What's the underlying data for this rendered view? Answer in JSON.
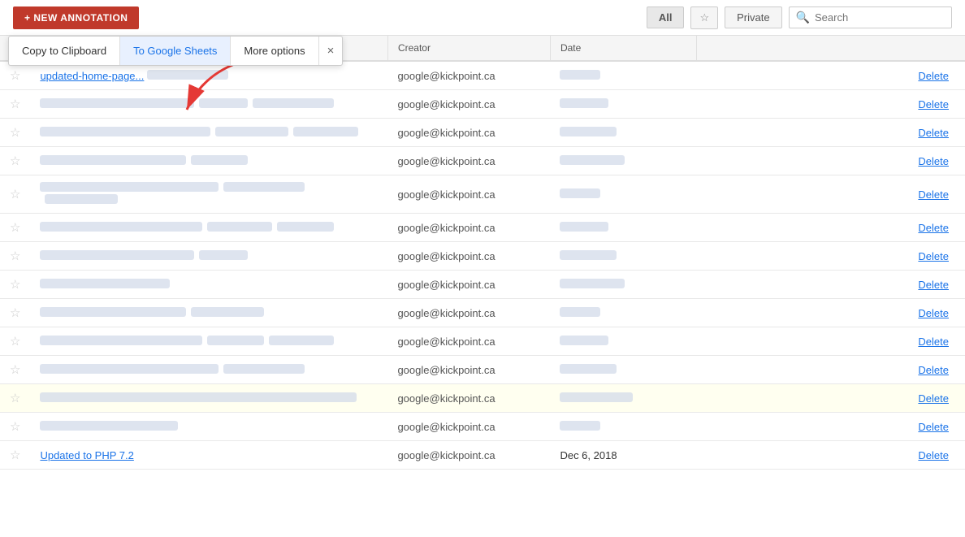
{
  "header": {
    "new_annotation_label": "+ NEW ANNOTATION",
    "filter_all": "All",
    "filter_private": "Private",
    "search_placeholder": "Search"
  },
  "export_popup": {
    "copy_label": "Copy to Clipboard",
    "sheets_label": "To Google Sheets",
    "more_label": "More options",
    "close_label": "×"
  },
  "table": {
    "col_sort_arrow": "↑",
    "col_creator": "Creator",
    "col_date": "Date",
    "delete_label": "Delete",
    "rows": [
      {
        "star": false,
        "content_link": "updated-home-page...",
        "content_blur_widths": [
          200,
          80
        ],
        "creator": "google@kickpoint.ca",
        "date": "",
        "highlighted": false
      },
      {
        "star": false,
        "content_link": "",
        "content_blur_widths": [
          190,
          60,
          100
        ],
        "creator": "google@kickpoint.ca",
        "date": "",
        "highlighted": false
      },
      {
        "star": false,
        "content_link": "",
        "content_blur_widths": [
          210,
          90,
          80
        ],
        "creator": "google@kickpoint.ca",
        "date": "",
        "highlighted": false
      },
      {
        "star": false,
        "content_link": "",
        "content_blur_widths": [
          180,
          70
        ],
        "creator": "google@kickpoint.ca",
        "date": "",
        "highlighted": false
      },
      {
        "star": false,
        "content_link": "",
        "content_blur_widths": [
          220,
          100,
          90
        ],
        "creator": "google@kickpoint.ca",
        "date": "",
        "highlighted": false
      },
      {
        "star": false,
        "content_link": "",
        "content_blur_widths": [
          200,
          80,
          70
        ],
        "creator": "google@kickpoint.ca",
        "date": "",
        "highlighted": false
      },
      {
        "star": false,
        "content_link": "",
        "content_blur_widths": [
          190,
          60
        ],
        "creator": "google@kickpoint.ca",
        "date": "",
        "highlighted": false
      },
      {
        "star": false,
        "content_link": "",
        "content_blur_widths": [
          160
        ],
        "creator": "google@kickpoint.ca",
        "date": "",
        "highlighted": false
      },
      {
        "star": false,
        "content_link": "",
        "content_blur_widths": [
          180,
          90
        ],
        "creator": "google@kickpoint.ca",
        "date": "",
        "highlighted": false
      },
      {
        "star": false,
        "content_link": "",
        "content_blur_widths": [
          200,
          70,
          80
        ],
        "creator": "google@kickpoint.ca",
        "date": "",
        "highlighted": false
      },
      {
        "star": false,
        "content_link": "",
        "content_blur_widths": [
          220,
          100
        ],
        "creator": "google@kickpoint.ca",
        "date": "",
        "highlighted": false
      },
      {
        "star": false,
        "content_link": "",
        "content_blur_widths": [
          390
        ],
        "creator": "google@kickpoint.ca",
        "date": "",
        "highlighted": true
      },
      {
        "star": false,
        "content_link": "",
        "content_blur_widths": [
          170
        ],
        "creator": "google@kickpoint.ca",
        "date": "",
        "highlighted": false
      },
      {
        "star": false,
        "content_link": "Updated to PHP 7.2",
        "content_blur_widths": [],
        "creator": "google@kickpoint.ca",
        "date": "Dec 6, 2018",
        "highlighted": false
      }
    ]
  }
}
